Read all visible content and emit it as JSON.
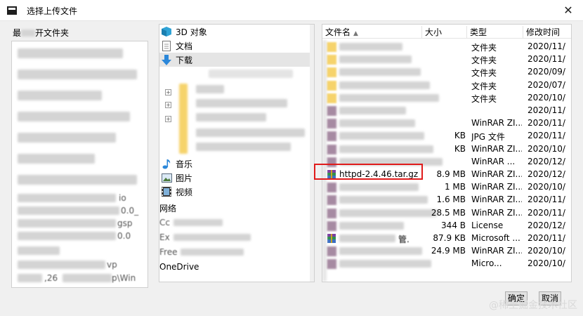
{
  "window": {
    "title": "选择上传文件",
    "close_glyph": "✕"
  },
  "recent": {
    "header_start": "最",
    "header_end": "开文件夹",
    "rows": [
      "io",
      "0.0_",
      "gsp",
      "0.0",
      "vp",
      ",26",
      "p\\Win"
    ]
  },
  "tree": {
    "items": [
      {
        "label": "3D 对象",
        "icon": "cube-3d-icon"
      },
      {
        "label": "文档",
        "icon": "document-icon"
      },
      {
        "label": "下载",
        "icon": "download-arrow-icon"
      },
      {
        "label": "音乐",
        "icon": "music-note-icon"
      },
      {
        "label": "图片",
        "icon": "picture-icon"
      },
      {
        "label": "视频",
        "icon": "video-icon"
      },
      {
        "label": "网络",
        "icon": ""
      },
      {
        "label": "Co",
        "icon": ""
      },
      {
        "label": "Ex",
        "icon": ""
      },
      {
        "label": "Free",
        "icon": ""
      },
      {
        "label": "OneDrive",
        "icon": ""
      }
    ],
    "fragments": [
      "网络",
      "Cc",
      "Ex",
      "Free",
      "OneDrive"
    ]
  },
  "files": {
    "columns": {
      "name": "文件名",
      "size": "大小",
      "type": "类型",
      "date": "修改时间"
    },
    "rows": [
      {
        "name": "",
        "size": "",
        "type": "文件夹",
        "date": "2020/11/"
      },
      {
        "name": "",
        "size": "",
        "type": "文件夹",
        "date": "2020/11/"
      },
      {
        "name": "",
        "size": "",
        "type": "文件夹",
        "date": "2020/09/"
      },
      {
        "name": "",
        "size": "",
        "type": "文件夹",
        "date": "2020/07/"
      },
      {
        "name": "",
        "size": "",
        "type": "文件夹",
        "date": "2020/10/"
      },
      {
        "name": "",
        "size": "",
        "type": "",
        "date": "2020/11/"
      },
      {
        "name": "",
        "size": "",
        "type": "WinRAR ZI...",
        "date": "2020/11/"
      },
      {
        "name": "",
        "size": "KB",
        "type": "JPG 文件",
        "date": "2020/11/"
      },
      {
        "name": "",
        "size": "KB",
        "type": "WinRAR ZI...",
        "date": "2020/10/"
      },
      {
        "name": "",
        "size": "",
        "type": "WinRAR ...",
        "date": "2020/12/"
      },
      {
        "name": "httpd-2.4.46.tar.gz",
        "size": "8.9 MB",
        "type": "WinRAR ZI...",
        "date": "2020/12/"
      },
      {
        "name": "",
        "size": "1 MB",
        "type": "WinRAR ZI...",
        "date": "2020/10/"
      },
      {
        "name": "",
        "size": "1.6 MB",
        "type": "WinRAR ZI...",
        "date": "2020/11/"
      },
      {
        "name": "",
        "size": "28.5 MB",
        "type": "WinRAR ZI...",
        "date": "2020/11/"
      },
      {
        "name": "",
        "size": "344 B",
        "type": "License",
        "date": "2020/12/"
      },
      {
        "name": "管.",
        "size": "87.9 KB",
        "type": "Microsoft ...",
        "date": "2020/11/"
      },
      {
        "name": "",
        "size": "24.9 MB",
        "type": "WinRAR ZI...",
        "date": "2020/10/"
      },
      {
        "name": "",
        "size": "",
        "type": "Micro...",
        "date": "2020/10/"
      }
    ]
  },
  "buttons": {
    "ok": "确定",
    "cancel": "取消"
  },
  "watermark": "@稀土掘金技术社区",
  "colors": {
    "highlight": "#e01b1b",
    "folder": "#f6d36b",
    "download": "#2b87d9"
  }
}
